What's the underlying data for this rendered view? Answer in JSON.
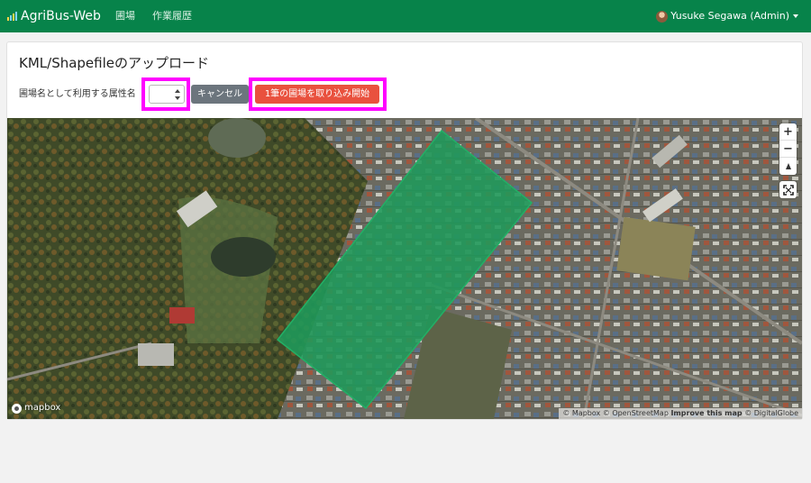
{
  "navbar": {
    "brand": "AgriBus-Web",
    "links": [
      "圃場",
      "作業履歴"
    ],
    "user": "Yusuke Segawa (Admin)",
    "color": "#07834a"
  },
  "upload": {
    "title": "KML/Shapefileのアップロード",
    "attribute_label": "圃場名として利用する属性名",
    "attribute_selected": "",
    "cancel_label": "キャンセル",
    "start_label": "1筆の圃場を取り込み開始",
    "start_color": "#e9513e",
    "cancel_color": "#6c757d",
    "highlight_color": "#ff00ff"
  },
  "map": {
    "controls": {
      "zoom_in": "+",
      "zoom_out": "−",
      "compass_icon": "compass-icon",
      "fullscreen_icon": "fullscreen-icon"
    },
    "logo": "mapbox",
    "attribution": {
      "mapbox": "© Mapbox",
      "osm": "© OpenStreetMap",
      "improve": "Improve this map",
      "digitalglobe": "© DigitalGlobe"
    },
    "field_polygon_color": "#1f9a5a"
  }
}
